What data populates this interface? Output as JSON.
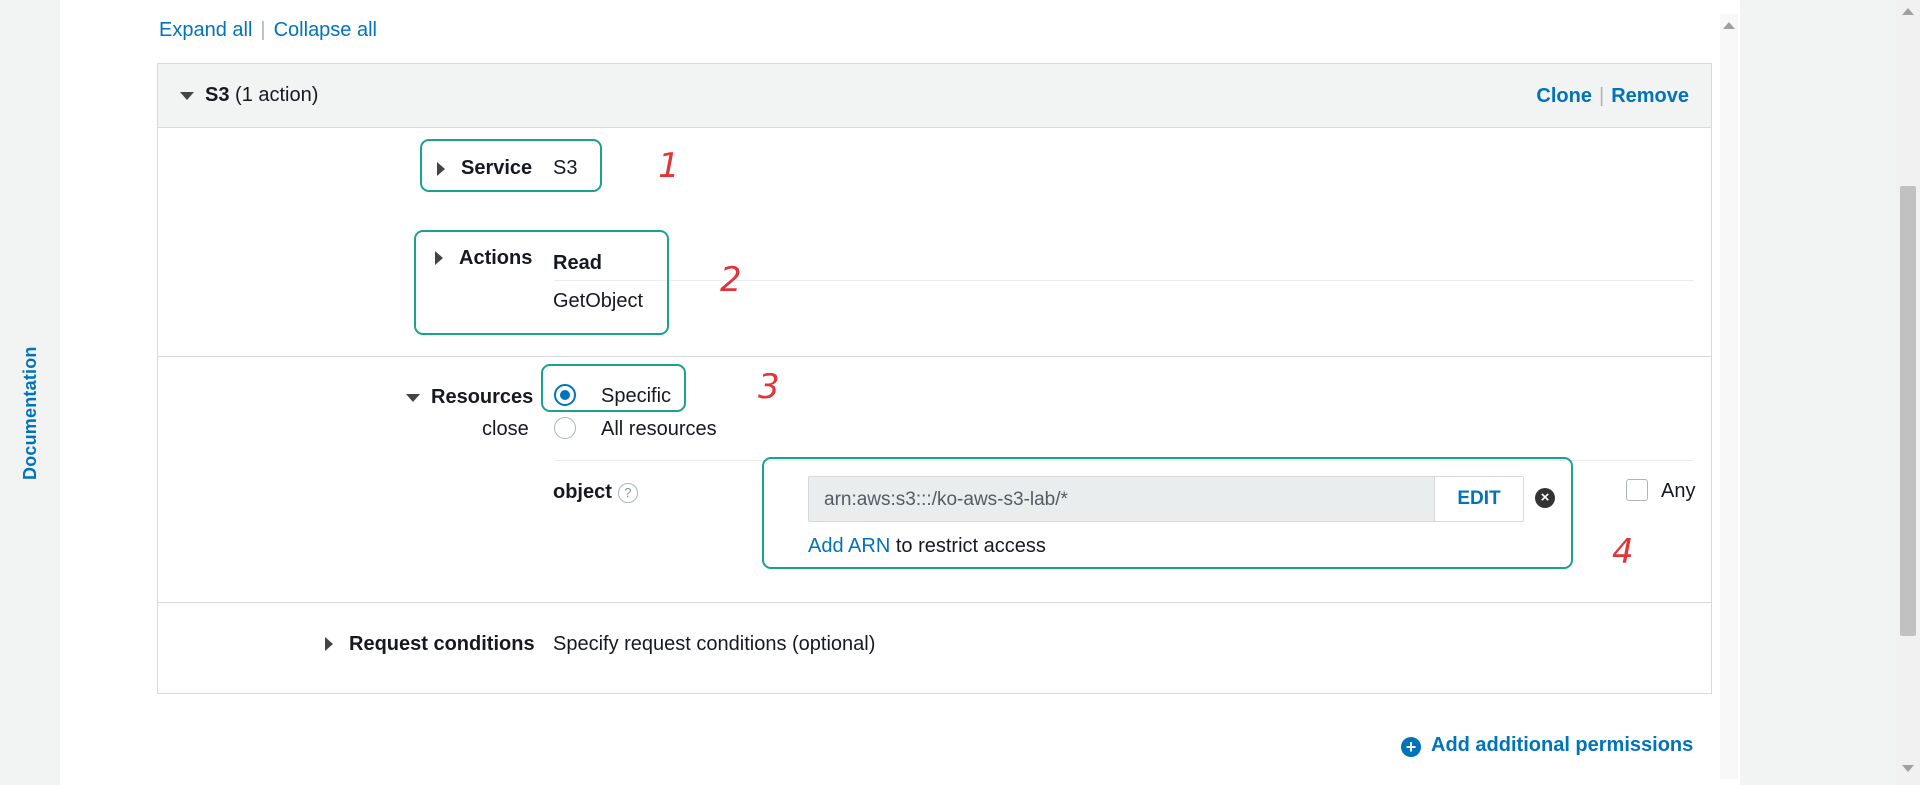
{
  "sidebar": {
    "documentation_label": "Documentation"
  },
  "toolbar": {
    "expand_all": "Expand all",
    "collapse_all": "Collapse all"
  },
  "service_block": {
    "service_name": "S3",
    "action_count": "(1 action)",
    "clone_label": "Clone",
    "remove_label": "Remove",
    "service": {
      "label": "Service",
      "value": "S3"
    },
    "actions": {
      "label": "Actions",
      "group": "Read",
      "items": [
        "GetObject"
      ]
    },
    "resources": {
      "label": "Resources",
      "close_label": "close",
      "options": [
        {
          "label": "Specific",
          "selected": true
        },
        {
          "label": "All resources",
          "selected": false
        }
      ],
      "object": {
        "label": "object",
        "help_icon": "?",
        "arn_value": "arn:aws:s3:::/ko-aws-s3-lab/*",
        "edit_label": "EDIT",
        "remove_icon": "×",
        "add_arn_label": "Add ARN",
        "restrict_text": "to restrict access",
        "any_label": "Any"
      }
    },
    "request_conditions": {
      "label": "Request conditions",
      "link": "Specify request conditions (optional)"
    }
  },
  "add_permissions": {
    "label": "Add additional permissions",
    "icon": "plus-circle-icon"
  },
  "annotations": [
    "1",
    "2",
    "3",
    "4"
  ],
  "colors": {
    "link": "#0073bb",
    "annotation_box": "#1aa38a",
    "annotation_number": "#e0353a"
  }
}
